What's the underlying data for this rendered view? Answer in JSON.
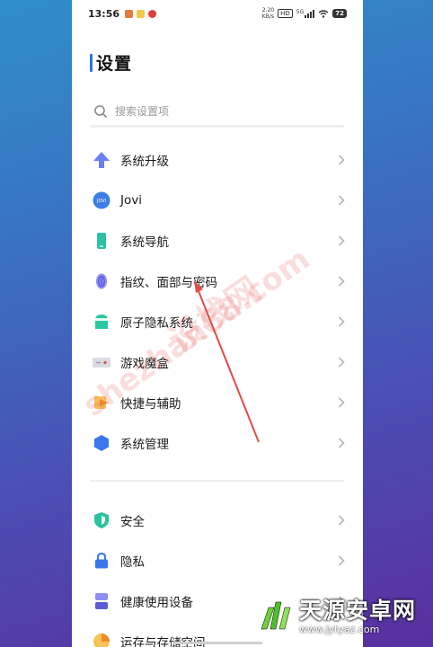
{
  "status_bar": {
    "time": "13:56",
    "speed_top": "2.20",
    "speed_bottom": "KB/s",
    "hd_label": "HD",
    "network_label": "5G",
    "battery": "72"
  },
  "header": {
    "title": "设置"
  },
  "search": {
    "placeholder": "搜索设置项"
  },
  "group1": [
    {
      "label": "系统升级",
      "icon": "upgrade-arrow-icon"
    },
    {
      "label": "Jovi",
      "icon": "jovi-icon",
      "icon_text": "JOVI"
    },
    {
      "label": "系统导航",
      "icon": "phone-navigation-icon"
    },
    {
      "label": "指纹、面部与密码",
      "icon": "fingerprint-icon"
    },
    {
      "label": "原子隐私系统",
      "icon": "privacy-system-icon"
    },
    {
      "label": "游戏魔盒",
      "icon": "game-box-icon"
    },
    {
      "label": "快捷与辅助",
      "icon": "shortcut-icon"
    },
    {
      "label": "系统管理",
      "icon": "system-management-icon"
    }
  ],
  "group2": [
    {
      "label": "安全",
      "icon": "security-shield-icon"
    },
    {
      "label": "隐私",
      "icon": "privacy-lock-icon"
    },
    {
      "label": "健康使用设备",
      "icon": "hourglass-icon"
    },
    {
      "label": "运存与存储空间",
      "icon": "storage-icon"
    }
  ],
  "watermark": {
    "text": "设栈网",
    "url": "shezhan88.com"
  },
  "brand": {
    "name": "天源安卓网",
    "url": "www.jytyaz.com"
  },
  "colors": {
    "accent": "#2e6ff2",
    "arrow": "#e24a4a"
  }
}
